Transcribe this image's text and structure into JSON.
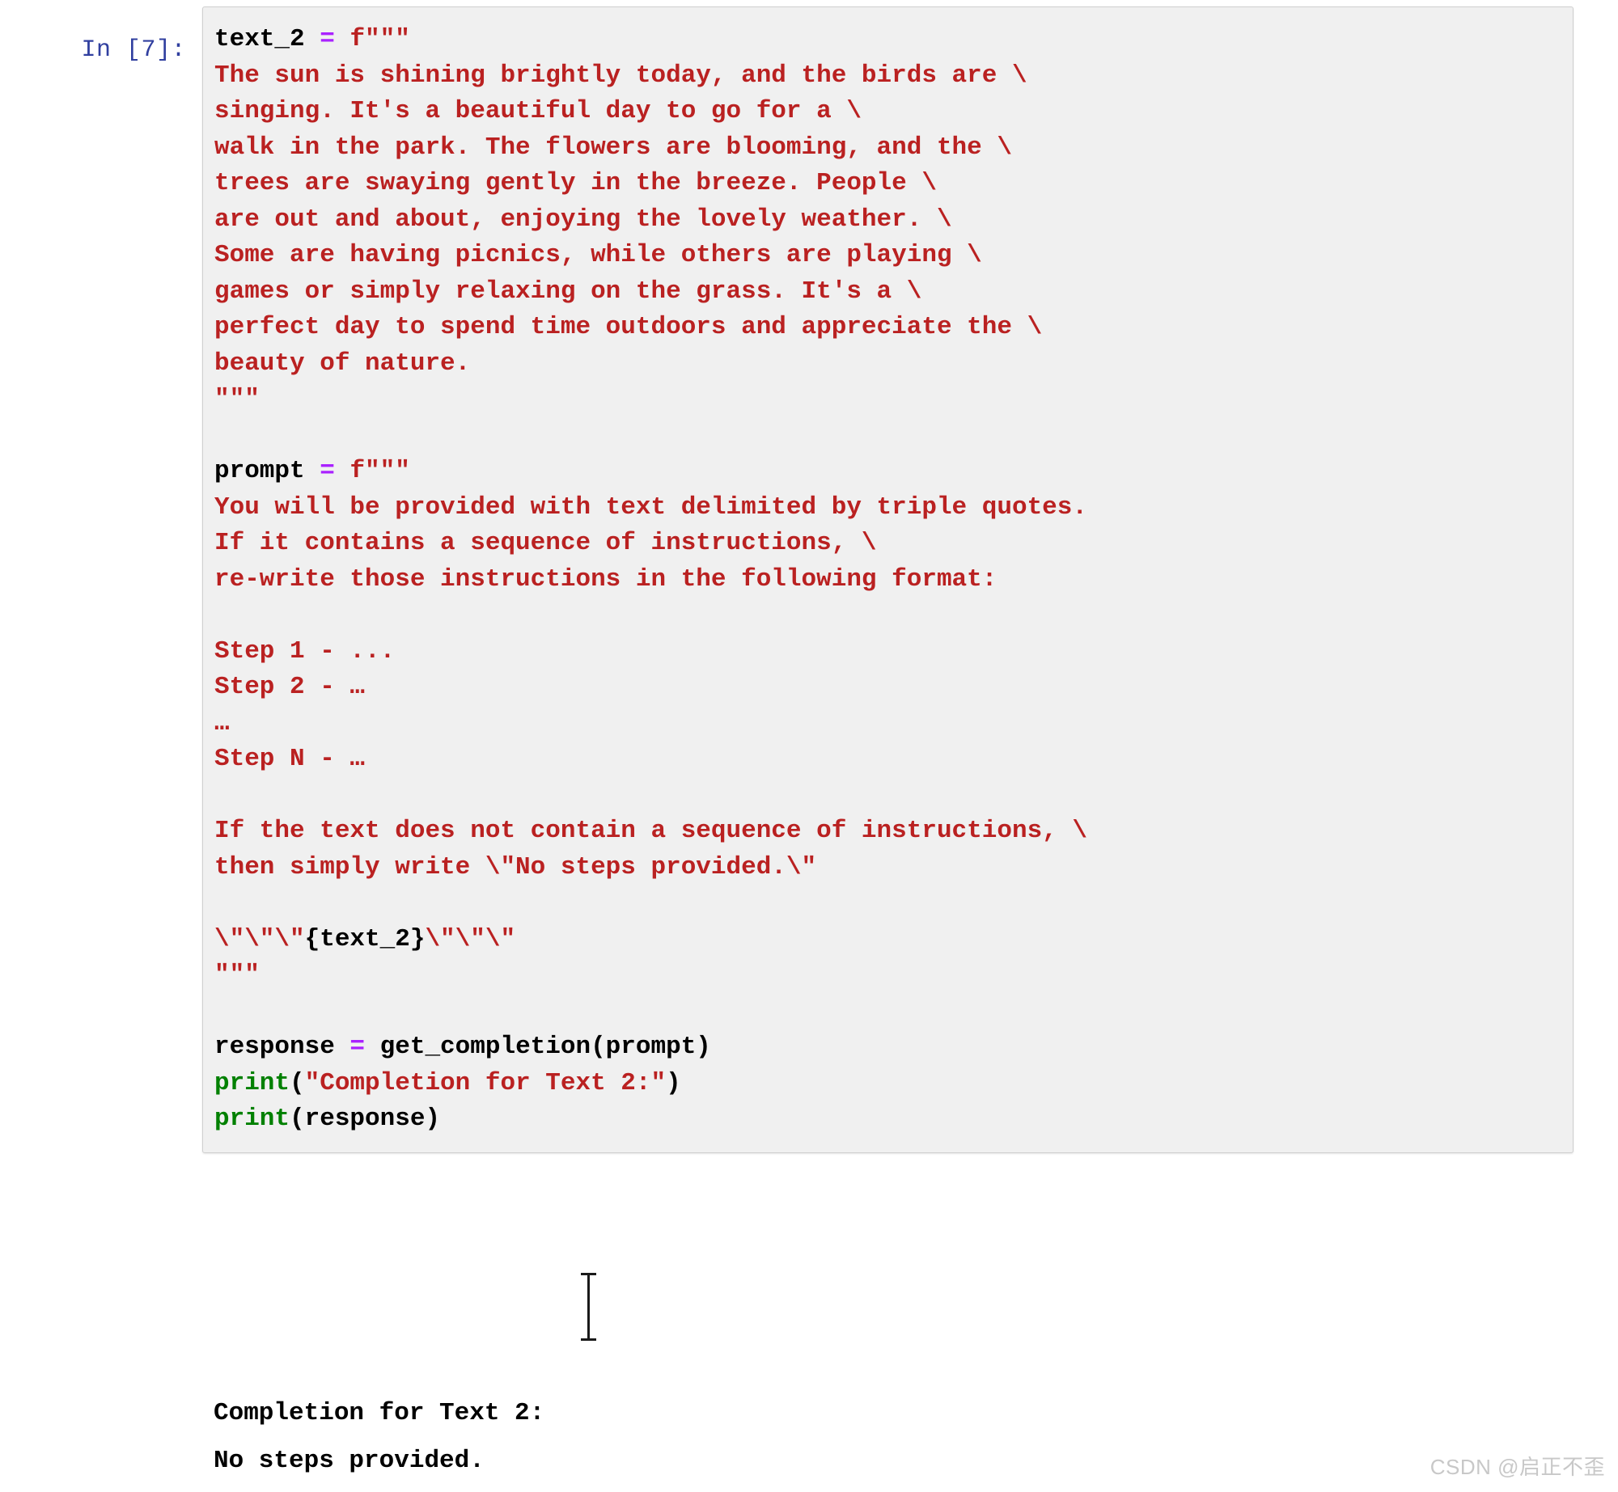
{
  "cell": {
    "prompt_label": "In [7]:",
    "execution_count": 7,
    "colors": {
      "prompt": "#303f9f",
      "cell_background": "#f0f0f0",
      "cell_border": "#cfcfcf",
      "string": "#ba2121",
      "operator": "#aa22ff",
      "builtin": "#008000",
      "name": "#000000",
      "output_text": "#000000",
      "watermark": "#c8c8c8"
    },
    "code_lines": {
      "l01_var": "text_2",
      "l01_op": " = ",
      "l01_fstr": "f\"\"\"",
      "l02": "The sun is shining brightly today, and the birds are \\",
      "l03": "singing. It's a beautiful day to go for a \\",
      "l04": "walk in the park. The flowers are blooming, and the \\",
      "l05": "trees are swaying gently in the breeze. People \\",
      "l06": "are out and about, enjoying the lovely weather. \\",
      "l07": "Some are having picnics, while others are playing \\",
      "l08": "games or simply relaxing on the grass. It's a \\",
      "l09": "perfect day to spend time outdoors and appreciate the \\",
      "l10": "beauty of nature.",
      "l11_close": "\"\"\"",
      "l12_blank": "",
      "l13_var": "prompt",
      "l13_op": " = ",
      "l13_fstr": "f\"\"\"",
      "l14": "You will be provided with text delimited by triple quotes.",
      "l15": "If it contains a sequence of instructions, \\",
      "l16": "re-write those instructions in the following format:",
      "l17_blank": "",
      "l18": "Step 1 - ...",
      "l19": "Step 2 - …",
      "l20": "…",
      "l21": "Step N - …",
      "l22_blank": "",
      "l23": "If the text does not contain a sequence of instructions, \\",
      "l24": "then simply write \\\"No steps provided.\\\"",
      "l25_blank": "",
      "l26_escapes_open": "\\\"\\\"\\\"",
      "l26_interp": "{text_2}",
      "l26_escapes_close": "\\\"\\\"\\\"",
      "l27_close": "\"\"\"",
      "l28_blank": "",
      "l29_var": "response",
      "l29_op": " = ",
      "l29_call": "get_completion(prompt)",
      "l30_builtin": "print",
      "l30_paren_open": "(",
      "l30_str": "\"Completion for Text 2:\"",
      "l30_paren_close": ")",
      "l31_builtin": "print",
      "l31_rest": "(response)"
    }
  },
  "output": {
    "line_1": "Completion for Text 2:",
    "line_2": "No steps provided."
  },
  "watermark": {
    "text": "CSDN @启正不歪"
  }
}
